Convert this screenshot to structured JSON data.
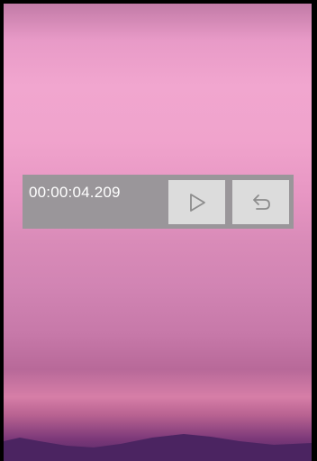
{
  "widget": {
    "elapsed_time": "00:00:04.209",
    "play_icon": "play-icon",
    "reset_icon": "undo-icon"
  },
  "colors": {
    "widget_background": "#9a969a",
    "button_background": "#dcdcdc",
    "icon_color": "#8c8c8c",
    "time_text": "#ffffff"
  }
}
